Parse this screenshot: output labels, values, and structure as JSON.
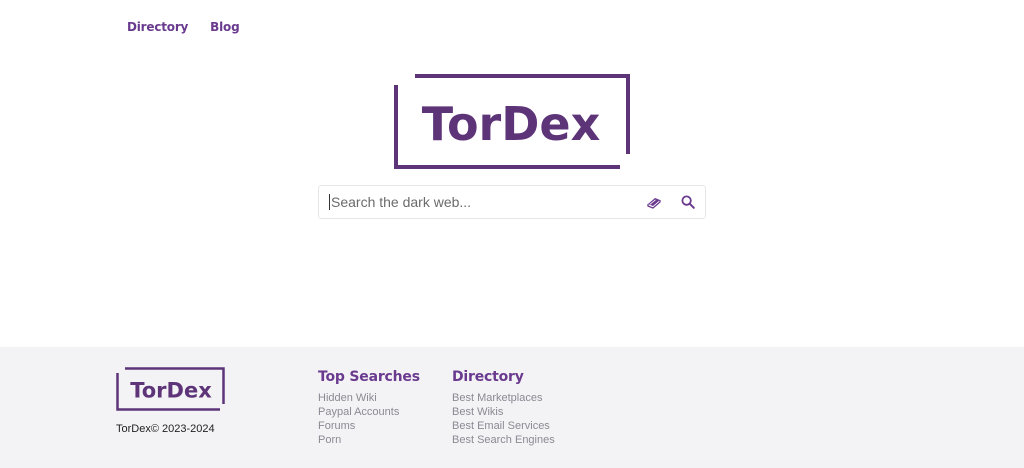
{
  "nav": {
    "directory": "Directory",
    "blog": "Blog"
  },
  "logo": {
    "text": "TorDex",
    "color": "#5e3478"
  },
  "search": {
    "placeholder": "Search the dark web..."
  },
  "footer": {
    "logo_text": "TorDex",
    "copyright": "TorDex© 2023-2024",
    "top_searches": {
      "title": "Top Searches",
      "items": [
        "Hidden Wiki",
        "Paypal Accounts",
        "Forums",
        "Porn"
      ]
    },
    "directory": {
      "title": "Directory",
      "items": [
        "Best Marketplaces",
        "Best Wikis",
        "Best Email Services",
        "Best Search Engines"
      ]
    }
  },
  "colors": {
    "accent": "#6a3a8e",
    "footer_bg": "#f3f3f6"
  },
  "icons": {
    "search": "search-icon",
    "book": "book-icon"
  }
}
